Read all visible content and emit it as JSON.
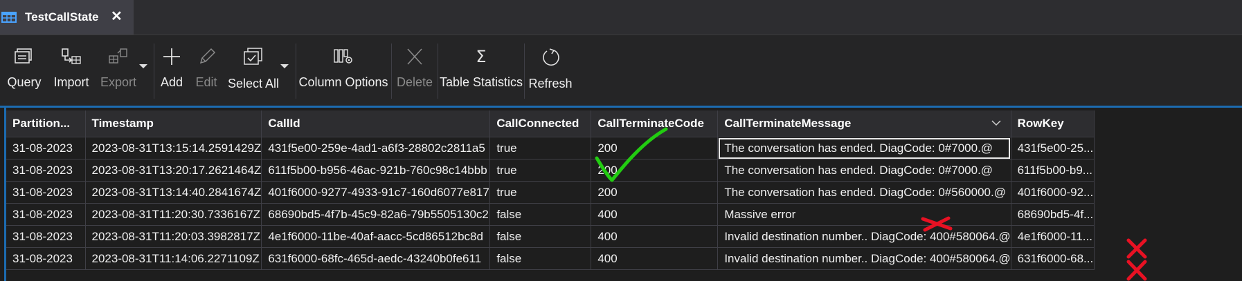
{
  "tab": {
    "title": "TestCallState",
    "icon": "table-icon",
    "close_icon": "close-icon"
  },
  "toolbar": {
    "query": "Query",
    "import": "Import",
    "export": "Export",
    "add": "Add",
    "edit": "Edit",
    "select_all": "Select All",
    "column_options": "Column Options",
    "delete": "Delete",
    "table_statistics": "Table Statistics",
    "refresh": "Refresh"
  },
  "columns": [
    "Partition...",
    "Timestamp",
    "CallId",
    "CallConnected",
    "CallTerminateCode",
    "CallTerminateMessage",
    "RowKey"
  ],
  "rows": [
    [
      "31-08-2023",
      "2023-08-31T13:15:14.2591429Z",
      "431f5e00-259e-4ad1-a6f3-28802c2811a5",
      "true",
      "200",
      "The conversation has ended. DiagCode: 0#7000.@",
      "431f5e00-25..."
    ],
    [
      "31-08-2023",
      "2023-08-31T13:20:17.2621464Z",
      "611f5b00-b956-46ac-921b-760c98c14bbb",
      "true",
      "200",
      "The conversation has ended. DiagCode: 0#7000.@",
      "611f5b00-b9..."
    ],
    [
      "31-08-2023",
      "2023-08-31T13:14:40.2841674Z",
      "401f6000-9277-4933-91c7-160d6077e817",
      "true",
      "200",
      "The conversation has ended. DiagCode: 0#560000.@",
      "401f6000-92..."
    ],
    [
      "31-08-2023",
      "2023-08-31T11:20:30.7336167Z",
      "68690bd5-4f7b-45c9-82a6-79b5505130c2",
      "false",
      "400",
      "Massive error",
      "68690bd5-4f..."
    ],
    [
      "31-08-2023",
      "2023-08-31T11:20:03.3982817Z",
      "4e1f6000-11be-40af-aacc-5cd86512bc8d",
      "false",
      "400",
      "Invalid destination number.. DiagCode: 400#580064.@",
      "4e1f6000-11..."
    ],
    [
      "31-08-2023",
      "2023-08-31T11:14:06.2271109Z",
      "631f6000-68fc-465d-aedc-43240b0fe611",
      "false",
      "400",
      "Invalid destination number.. DiagCode: 400#580064.@",
      "631f6000-68..."
    ]
  ],
  "colors": {
    "accent": "#1c6bb0",
    "check_mark": "#22cc11",
    "cross_mark": "#e81123"
  }
}
